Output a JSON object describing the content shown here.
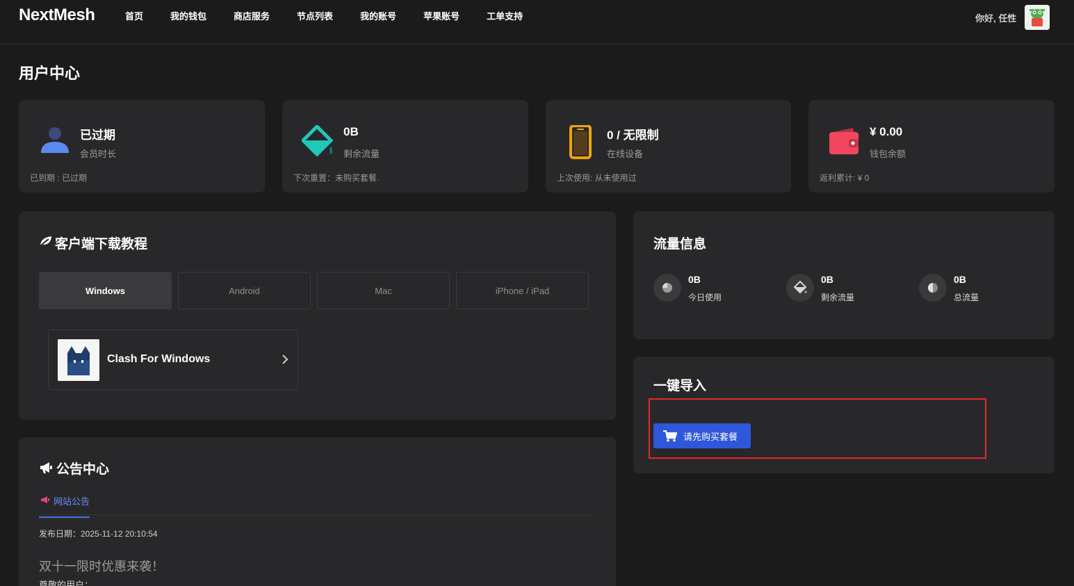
{
  "header": {
    "logo": "NextMesh",
    "nav": [
      "首页",
      "我的钱包",
      "商店服务",
      "节点列表",
      "我的账号",
      "苹果账号",
      "工单支持"
    ],
    "greeting": "你好, 任性"
  },
  "page_title": "用户中心",
  "stats": [
    {
      "value": "已过期",
      "label": "会员时长",
      "foot": "已到期 : 已过期",
      "icon": "user-icon",
      "color": "#5b8af0"
    },
    {
      "value": "0B",
      "label": "剩余流量",
      "foot": "下次重置：未购买套餐.",
      "icon": "paint-bucket-icon",
      "color": "#1fc8b8"
    },
    {
      "value": "0 / 无限制",
      "label": "在线设备",
      "foot": "上次使用: 从未使用过",
      "icon": "phone-icon",
      "color": "#f2a20c"
    },
    {
      "value": "¥ 0.00",
      "label": "钱包余额",
      "foot": "返利累计: ¥ 0",
      "icon": "wallet-icon",
      "color": "#f2465f"
    }
  ],
  "download": {
    "title": "客户端下载教程",
    "tabs": [
      "Windows",
      "Android",
      "Mac",
      "iPhone / iPad"
    ],
    "active_tab": "Windows",
    "app_name": "Clash For Windows"
  },
  "traffic": {
    "title": "流量信息",
    "items": [
      {
        "value": "0B",
        "label": "今日使用",
        "icon": "pie-chart-icon"
      },
      {
        "value": "0B",
        "label": "剩余流量",
        "icon": "paint-bucket-icon"
      },
      {
        "value": "0B",
        "label": "总流量",
        "icon": "half-circle-icon"
      }
    ]
  },
  "import": {
    "title": "一键导入",
    "button": "请先购买套餐"
  },
  "announce": {
    "title": "公告中心",
    "tab": "网站公告",
    "date": "发布日期：2025-11-12 20:10:54",
    "heading": "双十一限时优惠来袭！",
    "body": "尊敬的用户："
  }
}
